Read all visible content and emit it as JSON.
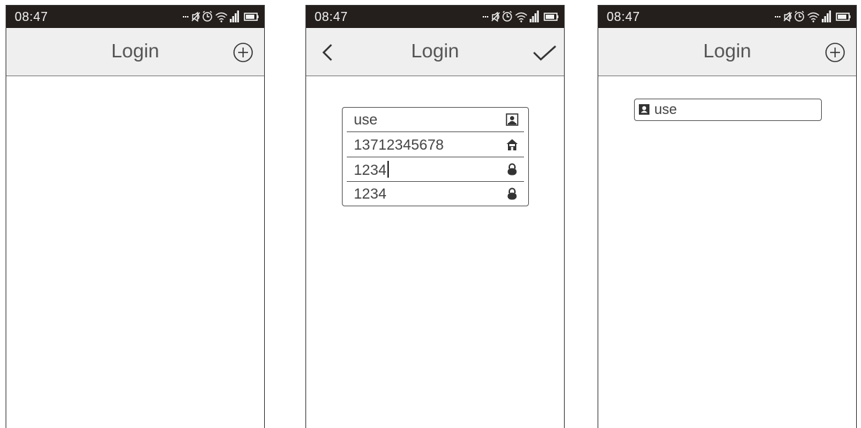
{
  "screens": [
    {
      "status_time": "08:47",
      "title": "Login",
      "right_icon": "add-circle-icon"
    },
    {
      "status_time": "08:47",
      "title": "Login",
      "left_icon": "chevron-left-icon",
      "right_icon": "checkmark-icon",
      "fields": [
        {
          "value": "use",
          "icon": "contact-card-icon"
        },
        {
          "value": "13712345678",
          "icon": "house-icon"
        },
        {
          "value": "1234",
          "icon": "lock-icon",
          "focused": true
        },
        {
          "value": "1234",
          "icon": "lock-icon"
        }
      ]
    },
    {
      "status_time": "08:47",
      "title": "Login",
      "right_icon": "add-circle-icon",
      "input": {
        "value": "use",
        "icon": "contact-card-icon"
      }
    }
  ],
  "status_icons": [
    "more-dots-icon",
    "mute-icon",
    "alarm-icon",
    "wifi-icon",
    "signal-icon",
    "battery-icon"
  ],
  "colors": {
    "statusbar_bg": "#241f1c",
    "navbar_bg": "#efefef",
    "text": "#444444"
  }
}
